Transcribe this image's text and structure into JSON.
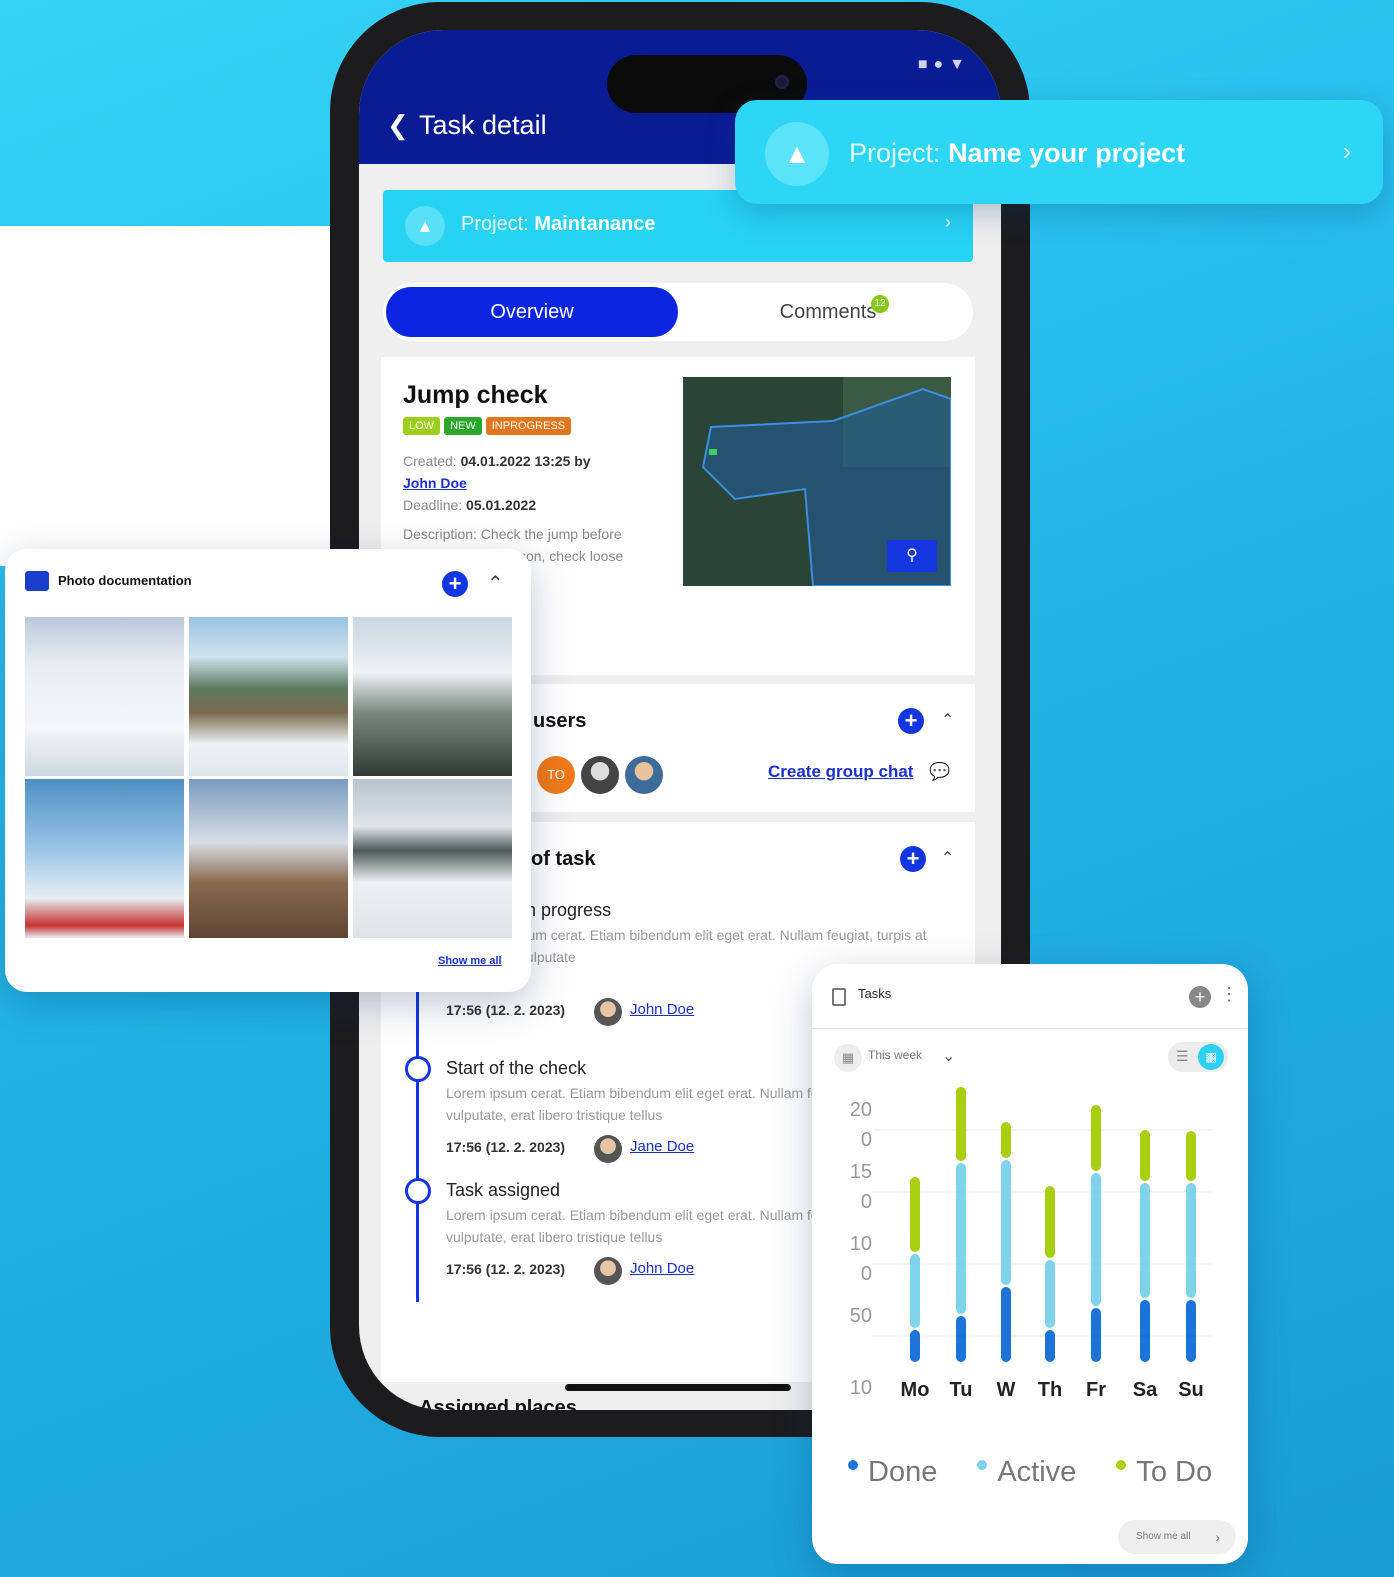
{
  "status_bar": {
    "icons": "■●▼"
  },
  "app_bar": {
    "back_icon": "chevron-left-icon",
    "title": "Task detail"
  },
  "project_bar": {
    "label": "Project:",
    "name": "Maintanance"
  },
  "banner": {
    "label": "Project:",
    "name": "Name your project"
  },
  "tabs": {
    "overview": "Overview",
    "comments": "Comments",
    "comments_badge": "12"
  },
  "task": {
    "title": "Jump check",
    "tags": [
      "LOW",
      "NEW",
      "INPROGRESS"
    ],
    "created_label": "Created:",
    "created_value": "04.01.2022 13:25 by",
    "created_by": "John Doe",
    "deadline_label": "Deadline:",
    "deadline_value": "05.01.2022",
    "description": "Description: Check the jump before the start of the season, check loose nails"
  },
  "users_section": {
    "title": "users",
    "avatar_initials": "TO",
    "group_chat_link": "Create group chat"
  },
  "history_section": {
    "title": "of task",
    "items": [
      {
        "title": "Check in progress",
        "body": "Lorem ipsum cerat. Etiam bibendum elit eget erat. Nullam feugiat, turpis at pulvinar vulputate",
        "time": "17:56 (12. 2. 2023)",
        "user": "John Doe"
      },
      {
        "title": "Start of the check",
        "body": "Lorem ipsum cerat. Etiam bibendum elit eget erat. Nullam feugiat, turpis at pulvinar vulputate, erat libero tristique tellus",
        "time": "17:56 (12. 2. 2023)",
        "user": "Jane Doe"
      },
      {
        "title": "Task assigned",
        "body": "Lorem ipsum cerat. Etiam bibendum elit eget erat. Nullam feugiat, turpis at pulvinar vulputate, erat libero tristique tellus",
        "time": "17:56 (12. 2. 2023)",
        "user": "John Doe"
      }
    ]
  },
  "next_section": {
    "title": "Assigned places"
  },
  "photo_card": {
    "title": "Photo documentation",
    "show_all": "Show me all"
  },
  "tasks_card": {
    "title": "Tasks",
    "period": "This week",
    "show_all": "Show me all",
    "colors": {
      "done": "#1c73d8",
      "active": "#7fd3ea",
      "todo": "#a9cf10"
    }
  },
  "chart_data": {
    "type": "bar",
    "stacked": true,
    "categories": [
      "Mo",
      "Tu",
      "W",
      "Th",
      "Fr",
      "Sa",
      "Su"
    ],
    "y_tick_labels": [
      "20",
      "0",
      "15",
      "0",
      "10",
      "0",
      "50",
      "10"
    ],
    "series": [
      {
        "name": "Done",
        "color": "#1c73d8",
        "values": [
          34,
          48,
          77,
          34,
          56,
          64,
          64
        ]
      },
      {
        "name": "Active",
        "color": "#7fd3ea",
        "values": [
          76,
          153,
          127,
          70,
          135,
          117,
          117
        ]
      },
      {
        "name": "To Do",
        "color": "#a9cf10",
        "values": [
          77,
          76,
          38,
          74,
          68,
          53,
          52
        ]
      }
    ],
    "legend_position": "bottom",
    "grid": true
  }
}
